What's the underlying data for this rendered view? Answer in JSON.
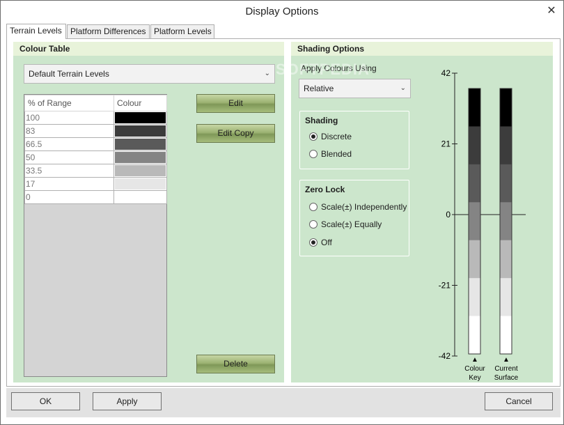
{
  "window": {
    "title": "Display Options",
    "close_glyph": "✕"
  },
  "tabs": [
    {
      "label": "Terrain Levels",
      "active": true
    },
    {
      "label": "Platform Differences",
      "active": false
    },
    {
      "label": "Platform Levels",
      "active": false
    }
  ],
  "colour_table": {
    "header": "Colour Table",
    "preset": "Default Terrain Levels",
    "columns": [
      "% of Range",
      "Colour"
    ],
    "rows": [
      {
        "pct": "100",
        "color": "#000000"
      },
      {
        "pct": "83",
        "color": "#3c3c3c"
      },
      {
        "pct": "66.5",
        "color": "#5a5a5a"
      },
      {
        "pct": "50",
        "color": "#848484"
      },
      {
        "pct": "33.5",
        "color": "#b9b9b9"
      },
      {
        "pct": "17",
        "color": "#e6e6e6"
      },
      {
        "pct": "0",
        "color": "#ffffff"
      }
    ],
    "edit_label": "Edit",
    "edit_copy_label": "Edit Copy",
    "delete_label": "Delete"
  },
  "shading_options": {
    "header": "Shading Options",
    "apply_label": "Apply Colours Using",
    "apply_value": "Relative",
    "shading": {
      "title": "Shading",
      "options": [
        {
          "label": "Discrete",
          "checked": true
        },
        {
          "label": "Blended",
          "checked": false
        }
      ]
    },
    "zero_lock": {
      "title": "Zero Lock",
      "options": [
        {
          "label": "Scale(±) Independently",
          "checked": false
        },
        {
          "label": "Scale(±) Equally",
          "checked": false
        },
        {
          "label": "Off",
          "checked": true
        }
      ]
    }
  },
  "scale": {
    "ticks": [
      "42",
      "21",
      "0",
      "-21",
      "-42"
    ],
    "colour_key_label": [
      "Colour",
      "Key"
    ],
    "current_surface_label": [
      "Current",
      "Surface"
    ],
    "bands": [
      "#000000",
      "#3c3c3c",
      "#5a5a5a",
      "#848484",
      "#b9b9b9",
      "#e6e6e6",
      "#ffffff"
    ]
  },
  "watermark": "SOFTPEDIA",
  "footer": {
    "ok_label": "OK",
    "apply_label": "Apply",
    "cancel_label": "Cancel"
  },
  "colors": {
    "panel_bg": "#cce6cc",
    "panel_header_bg": "#e8f3da",
    "footer_bg": "#e2e2e2"
  }
}
